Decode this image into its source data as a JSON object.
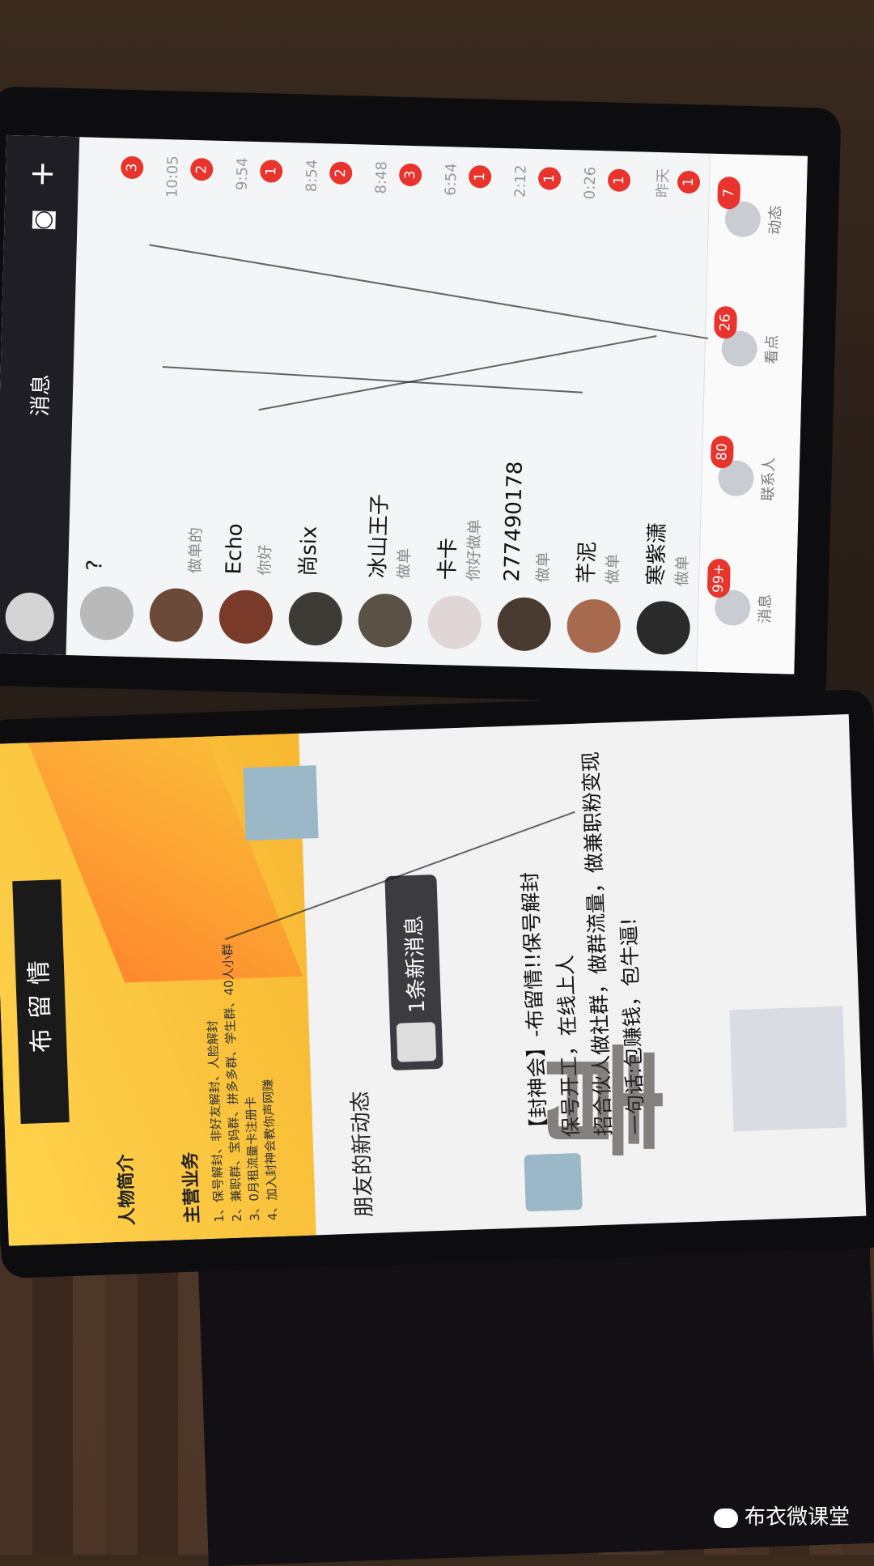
{
  "phone1": {
    "header": {
      "title": "消息"
    },
    "conversations": [
      {
        "name": "?",
        "preview": "",
        "time": "",
        "badge": "3",
        "color": "#b9b9b9"
      },
      {
        "name": "",
        "preview": "做单的",
        "time": "10:05",
        "badge": "2",
        "color": "#6b4a3a"
      },
      {
        "name": "Echo",
        "preview": "你好",
        "time": "9:54",
        "badge": "1",
        "color": "#7a3a2a"
      },
      {
        "name": "尚six",
        "preview": "",
        "time": "8:54",
        "badge": "2",
        "color": "#3d3b36"
      },
      {
        "name": "冰山王子",
        "preview": "做单",
        "time": "8:48",
        "badge": "3",
        "color": "#5a5245"
      },
      {
        "name": "卡卡",
        "preview": "你好做单",
        "time": "6:54",
        "badge": "1",
        "color": "#e0d6d6"
      },
      {
        "name": "277490178",
        "preview": "做单",
        "time": "2:12",
        "badge": "1",
        "color": "#4a3b30"
      },
      {
        "name": "芊泥",
        "preview": "做单",
        "time": "0:26",
        "badge": "1",
        "color": "#a86a4e"
      },
      {
        "name": "寒紫潇",
        "preview": "做单",
        "time": "昨天",
        "badge": "1",
        "color": "#2a2a2a"
      }
    ],
    "tabs": [
      {
        "label": "消息",
        "badge": "99+"
      },
      {
        "label": "联系人",
        "badge": "80"
      },
      {
        "label": "看点",
        "badge": "26"
      },
      {
        "label": "动态",
        "badge": "7"
      }
    ]
  },
  "phone2": {
    "banner": {
      "name": "布留情",
      "head1": "人物简介",
      "head2": "主营业务",
      "services": [
        "1、保号解封、非好友解封、人脸解封",
        "2、兼职群、宝妈群、拼多多群、学生群、40人小群",
        "3、0月租流量卡注册卡",
        "4、加入封神会教你声网赚"
      ]
    },
    "feed_title": "朋友的新动态",
    "new_message": "1条新消息",
    "post": {
      "line1": "【封神会】-布留情!!保号解封",
      "line2": "保号开工，在线上人",
      "line3": "招合伙人做社群，做群流量，做兼职粉变现",
      "line4": "一句话:包赚钱，包牛逼!"
    }
  },
  "watermark": "布衣微课堂"
}
